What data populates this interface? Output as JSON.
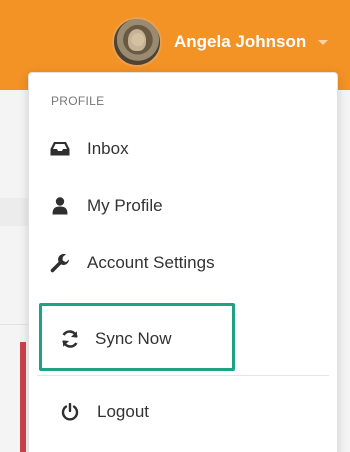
{
  "header": {
    "user_name": "Angela Johnson",
    "avatar_alt": "user-avatar",
    "accent_color": "#f39325"
  },
  "menu": {
    "section_title": "PROFILE",
    "items": [
      {
        "label": "Inbox",
        "icon": "inbox-icon"
      },
      {
        "label": "My Profile",
        "icon": "user-icon"
      },
      {
        "label": "Account Settings",
        "icon": "wrench-icon"
      },
      {
        "label": "Sync Now",
        "icon": "sync-icon",
        "highlighted": true
      },
      {
        "label": "Logout",
        "icon": "power-icon"
      }
    ],
    "highlight_color": "#1fa283"
  }
}
